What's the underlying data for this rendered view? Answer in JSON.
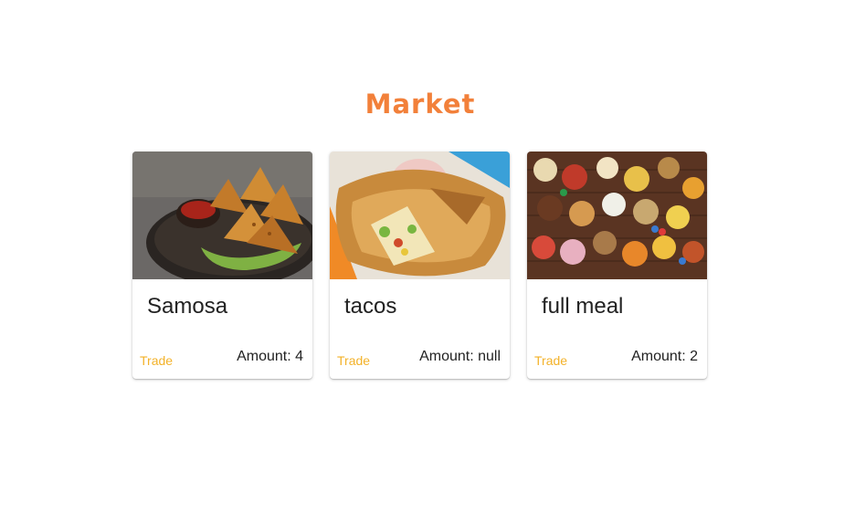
{
  "market": {
    "title": "Market",
    "cards": [
      {
        "name": "Samosa",
        "action_label": "Trade",
        "amount_text": "Amount: 4",
        "image": "samosa-photo"
      },
      {
        "name": "tacos",
        "action_label": "Trade",
        "amount_text": "Amount: null",
        "image": "crunchwrap-photo"
      },
      {
        "name": "full meal",
        "action_label": "Trade",
        "amount_text": "Amount: 2",
        "image": "snack-spread-photo"
      }
    ]
  },
  "colors": {
    "title": "#f2803a",
    "action": "#f3b229",
    "text": "#222222"
  }
}
